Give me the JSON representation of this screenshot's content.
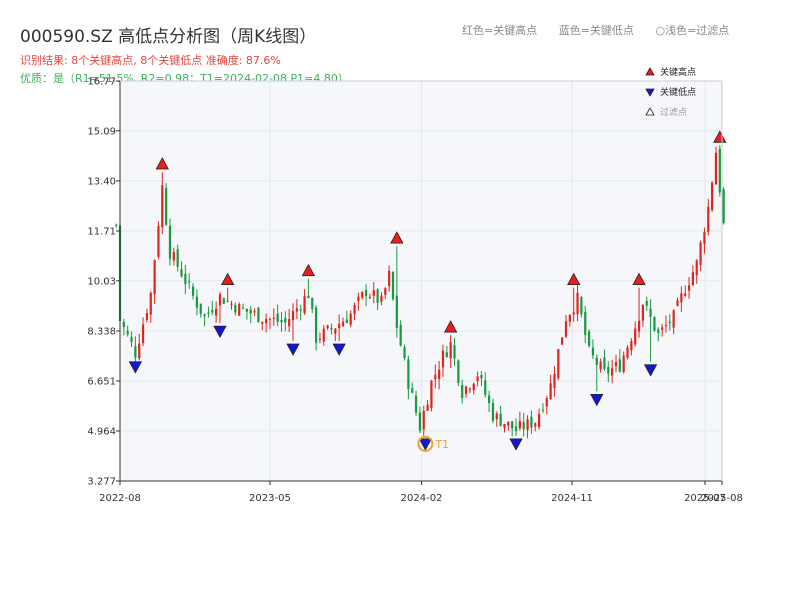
{
  "header": {
    "title": "000590.SZ 高低点分析图（周K线图）",
    "result_line": "识别结果: 8个关键高点, 8个关键低点   准确度: 87.6%",
    "quality_line": "优质：是（R1=51.5%, R2=0.98；T1=2024-02-08 P1=4.80）"
  },
  "top_legend": {
    "red": "红色=关键高点",
    "blue": "蓝色=关键低点",
    "pale": "○浅色=过滤点"
  },
  "colors": {
    "up": "#e0241d",
    "down": "#169a3f",
    "high_marker": "#ee1c1c",
    "low_marker": "#1515d8",
    "t1_marker": "#f0a030",
    "plot_bg": "#f5f7fa",
    "grid": "#e4e8ee"
  },
  "chart_data": {
    "type": "candlestick",
    "title": "000590.SZ 高低点分析图（周K线图）",
    "y_ticks": [
      "3.277",
      "4.964",
      "6.651",
      "8.338",
      "10.03",
      "11.71",
      "13.40",
      "15.09",
      "16.77"
    ],
    "x_ticks": [
      {
        "label": "2022-08",
        "date": "2022-08-01"
      },
      {
        "label": "2023-05",
        "date": "2023-05-01"
      },
      {
        "label": "2024-02",
        "date": "2024-02-01"
      },
      {
        "label": "2024-11",
        "date": "2024-11-01"
      },
      {
        "label": "2025-07",
        "date": "2025-07-01"
      },
      {
        "label": "2025-08",
        "date": "2025-08-01"
      }
    ],
    "ylim": [
      3.277,
      16.77
    ],
    "xlim": [
      "2022-08-01",
      "2025-08-01"
    ],
    "grid": true,
    "legend_position": "top-right",
    "legend": [
      {
        "label": "关键高点",
        "type": "high"
      },
      {
        "label": "关键低点",
        "type": "low"
      },
      {
        "label": "过滤点",
        "type": "filtered"
      }
    ],
    "close_path": [
      [
        "2022-08-01",
        8.7
      ],
      [
        "2022-08-29",
        7.6
      ],
      [
        "2022-09-26",
        9.6
      ],
      [
        "2022-10-17",
        13.2
      ],
      [
        "2022-10-31",
        11.0
      ],
      [
        "2022-11-21",
        10.3
      ],
      [
        "2022-12-12",
        9.5
      ],
      [
        "2023-01-02",
        8.8
      ],
      [
        "2023-01-30",
        9.5
      ],
      [
        "2023-03-06",
        9.1
      ],
      [
        "2023-04-17",
        8.8
      ],
      [
        "2023-05-29",
        8.6
      ],
      [
        "2023-07-10",
        9.6
      ],
      [
        "2023-07-24",
        8.1
      ],
      [
        "2023-08-21",
        8.4
      ],
      [
        "2023-09-25",
        8.9
      ],
      [
        "2023-10-23",
        9.7
      ],
      [
        "2023-11-20",
        9.3
      ],
      [
        "2023-12-04",
        10.2
      ],
      [
        "2023-12-18",
        8.5
      ],
      [
        "2024-01-08",
        6.6
      ],
      [
        "2024-01-29",
        5.1
      ],
      [
        "2024-02-19",
        6.6
      ],
      [
        "2024-03-11",
        7.5
      ],
      [
        "2024-03-25",
        7.9
      ],
      [
        "2024-04-15",
        6.3
      ],
      [
        "2024-05-13",
        6.9
      ],
      [
        "2024-06-10",
        5.5
      ],
      [
        "2024-07-22",
        5.0
      ],
      [
        "2024-08-26",
        5.3
      ],
      [
        "2024-09-23",
        6.5
      ],
      [
        "2024-10-21",
        8.8
      ],
      [
        "2024-11-11",
        9.4
      ],
      [
        "2024-12-02",
        7.6
      ],
      [
        "2024-12-30",
        6.9
      ],
      [
        "2025-01-27",
        7.2
      ],
      [
        "2025-02-24",
        8.5
      ],
      [
        "2025-03-10",
        9.3
      ],
      [
        "2025-04-07",
        8.2
      ],
      [
        "2025-05-05",
        8.8
      ],
      [
        "2025-05-26",
        9.8
      ],
      [
        "2025-06-16",
        10.6
      ],
      [
        "2025-07-07",
        12.5
      ],
      [
        "2025-07-21",
        14.4
      ],
      [
        "2025-08-04",
        11.9
      ]
    ],
    "key_highs": [
      {
        "date": "2022-10-17",
        "value": 13.7
      },
      {
        "date": "2023-02-13",
        "value": 9.8
      },
      {
        "date": "2023-07-10",
        "value": 10.1
      },
      {
        "date": "2023-12-18",
        "value": 11.2
      },
      {
        "date": "2024-03-25",
        "value": 8.2
      },
      {
        "date": "2024-11-04",
        "value": 9.8
      },
      {
        "date": "2025-03-03",
        "value": 9.8
      },
      {
        "date": "2025-07-28",
        "value": 14.6
      }
    ],
    "key_lows": [
      {
        "date": "2022-08-29",
        "value": 7.4
      },
      {
        "date": "2023-01-30",
        "value": 8.6
      },
      {
        "date": "2023-06-12",
        "value": 8.0
      },
      {
        "date": "2023-09-04",
        "value": 8.0
      },
      {
        "date": "2024-02-08",
        "value": 4.8
      },
      {
        "date": "2024-07-22",
        "value": 4.8
      },
      {
        "date": "2024-12-16",
        "value": 6.3
      },
      {
        "date": "2025-03-24",
        "value": 7.3
      }
    ],
    "t1": {
      "label": "T1",
      "date": "2024-02-08",
      "value": 4.8
    }
  }
}
